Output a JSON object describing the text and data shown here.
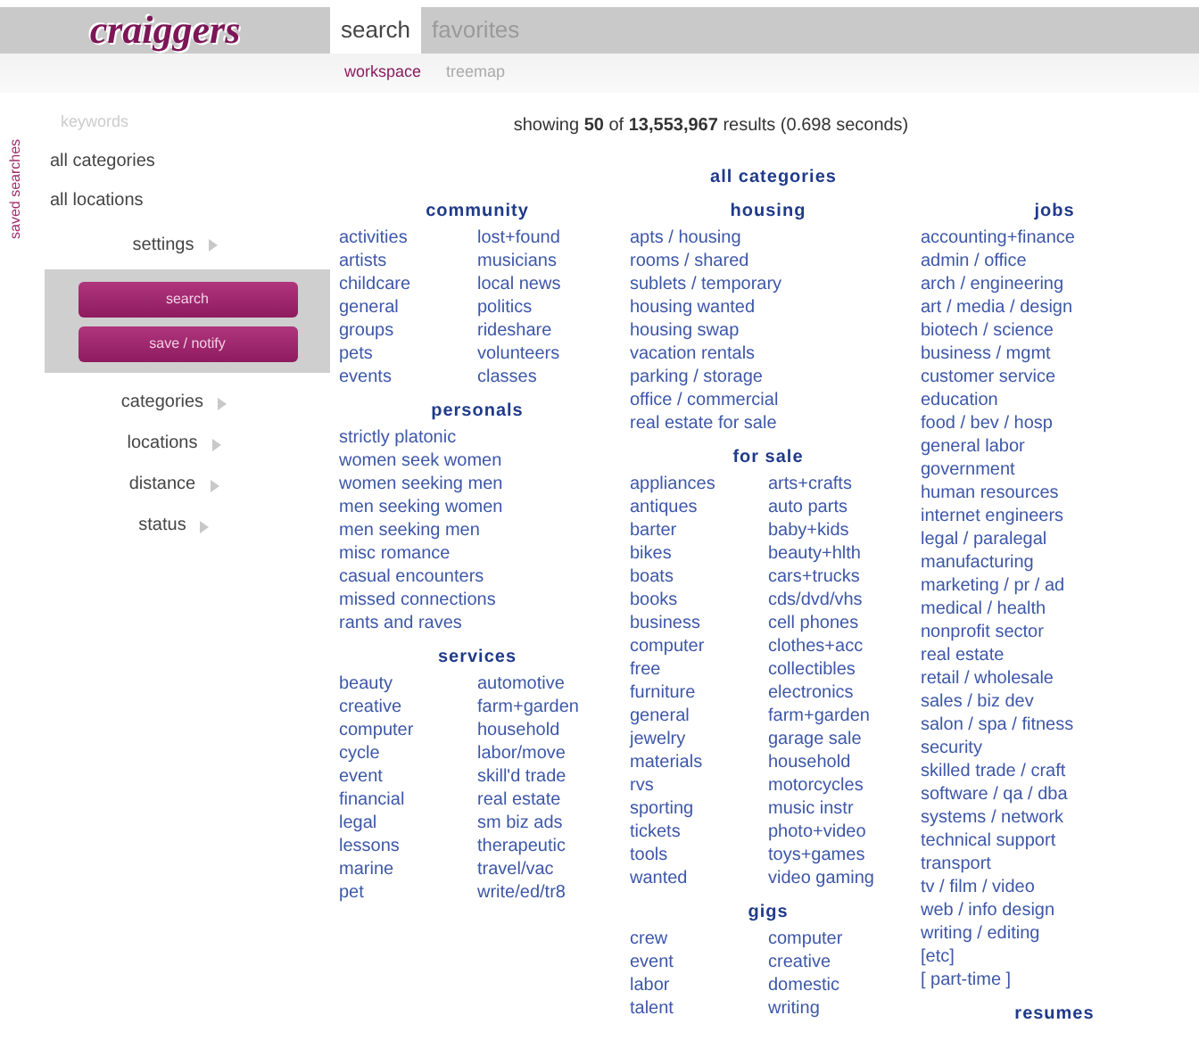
{
  "logo": "craiggers",
  "tabs": [
    {
      "label": "search",
      "selected": true
    },
    {
      "label": "favorites",
      "selected": false
    }
  ],
  "subtabs": [
    {
      "label": "workspace",
      "selected": true
    },
    {
      "label": "treemap",
      "selected": false
    }
  ],
  "sidebar": {
    "vertical_label": "saved searches",
    "keyword_placeholder": "keywords",
    "filters": [
      "all categories",
      "all locations"
    ],
    "settings": "settings",
    "buttons": [
      "search",
      "save / notify"
    ],
    "sections": [
      "categories",
      "locations",
      "distance",
      "status"
    ]
  },
  "results_summary": "showing **50** of **13,553,967** results (0.698 seconds)",
  "category_panel": {
    "title": "all categories",
    "columns": [
      [
        {
          "title": "community",
          "lists": [
            [
              "activities",
              "artists",
              "childcare",
              "general",
              "groups",
              "pets",
              "events"
            ],
            [
              "lost+found",
              "musicians",
              "local news",
              "politics",
              "rideshare",
              "volunteers",
              "classes"
            ]
          ]
        },
        {
          "title": "personals",
          "lists": [
            [
              "strictly platonic",
              "women seek women",
              "women seeking men",
              "men seeking women",
              "men seeking men",
              "misc romance",
              "casual encounters",
              "missed connections",
              "rants and raves"
            ]
          ]
        },
        {
          "title": "services",
          "lists": [
            [
              "beauty",
              "creative",
              "computer",
              "cycle",
              "event",
              "financial",
              "legal",
              "lessons",
              "marine",
              "pet"
            ],
            [
              "automotive",
              "farm+garden",
              "household",
              "labor/move",
              "skill'd trade",
              "real estate",
              "sm biz ads",
              "therapeutic",
              "travel/vac",
              "write/ed/tr8"
            ]
          ]
        }
      ],
      [
        {
          "title": "housing",
          "lists": [
            [
              "apts / housing",
              "rooms / shared",
              "sublets / temporary",
              "housing wanted",
              "housing swap",
              "vacation rentals",
              "parking / storage",
              "office / commercial",
              "real estate for sale"
            ]
          ]
        },
        {
          "title": "for sale",
          "lists": [
            [
              "appliances",
              "antiques",
              "barter",
              "bikes",
              "boats",
              "books",
              "business",
              "computer",
              "free",
              "furniture",
              "general",
              "jewelry",
              "materials",
              "rvs",
              "sporting",
              "tickets",
              "tools",
              "wanted"
            ],
            [
              "arts+crafts",
              "auto parts",
              "baby+kids",
              "beauty+hlth",
              "cars+trucks",
              "cds/dvd/vhs",
              "cell phones",
              "clothes+acc",
              "collectibles",
              "electronics",
              "farm+garden",
              "garage sale",
              "household",
              "motorcycles",
              "music instr",
              "photo+video",
              "toys+games",
              "video gaming"
            ]
          ]
        },
        {
          "title": "gigs",
          "lists": [
            [
              "crew",
              "event",
              "labor",
              "talent"
            ],
            [
              "computer",
              "creative",
              "domestic",
              "writing"
            ]
          ]
        }
      ],
      [
        {
          "title": "jobs",
          "lists": [
            [
              "accounting+finance",
              "admin / office",
              "arch / engineering",
              "art / media / design",
              "biotech / science",
              "business / mgmt",
              "customer service",
              "education",
              "food / bev / hosp",
              "general labor",
              "government",
              "human resources",
              "internet engineers",
              "legal / paralegal",
              "manufacturing",
              "marketing / pr / ad",
              "medical / health",
              "nonprofit sector",
              "real estate",
              "retail / wholesale",
              "sales / biz dev",
              "salon / spa / fitness",
              "security",
              "skilled trade / craft",
              "software / qa / dba",
              "systems / network",
              "technical support",
              "transport",
              "tv / film / video",
              "web / info design",
              "writing / editing",
              "[etc]",
              "[ part-time ]"
            ]
          ]
        },
        {
          "title": "resumes"
        }
      ]
    ]
  }
}
